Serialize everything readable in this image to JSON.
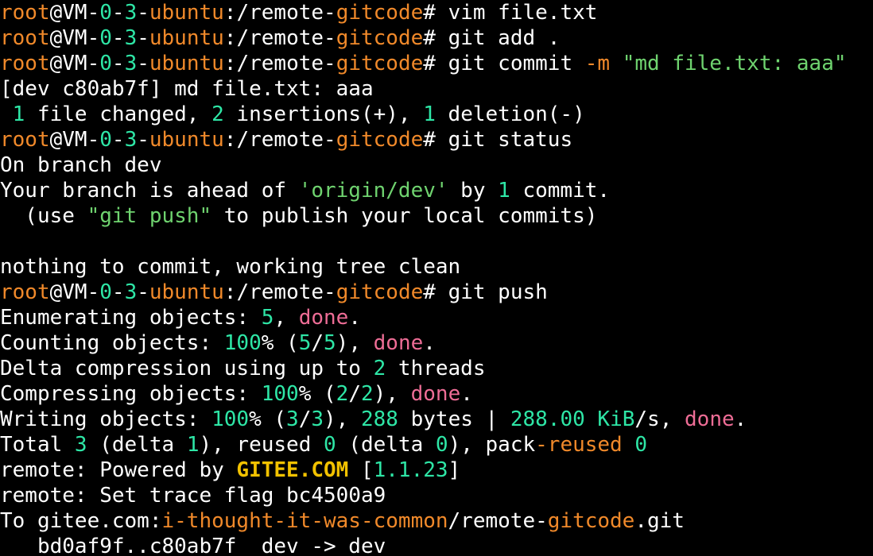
{
  "terminal": {
    "colors": {
      "background": "#000000",
      "foreground": "#ffffff",
      "orange": "#f0892a",
      "number_green": "#2ee6a6",
      "string_green": "#6fd36f",
      "pink": "#ee6d96",
      "yellow": "#f2c200"
    },
    "lines": [
      [
        {
          "t": "root",
          "c": "orange"
        },
        {
          "t": "@VM-",
          "c": "white"
        },
        {
          "t": "0",
          "c": "green"
        },
        {
          "t": "-",
          "c": "white"
        },
        {
          "t": "3",
          "c": "green"
        },
        {
          "t": "-",
          "c": "white"
        },
        {
          "t": "ubuntu",
          "c": "orange"
        },
        {
          "t": ":/remote-",
          "c": "white"
        },
        {
          "t": "gitcode",
          "c": "orange"
        },
        {
          "t": "# vim file.txt",
          "c": "white"
        }
      ],
      [
        {
          "t": "root",
          "c": "orange"
        },
        {
          "t": "@VM-",
          "c": "white"
        },
        {
          "t": "0",
          "c": "green"
        },
        {
          "t": "-",
          "c": "white"
        },
        {
          "t": "3",
          "c": "green"
        },
        {
          "t": "-",
          "c": "white"
        },
        {
          "t": "ubuntu",
          "c": "orange"
        },
        {
          "t": ":/remote-",
          "c": "white"
        },
        {
          "t": "gitcode",
          "c": "orange"
        },
        {
          "t": "# git add .",
          "c": "white"
        }
      ],
      [
        {
          "t": "root",
          "c": "orange"
        },
        {
          "t": "@VM-",
          "c": "white"
        },
        {
          "t": "0",
          "c": "green"
        },
        {
          "t": "-",
          "c": "white"
        },
        {
          "t": "3",
          "c": "green"
        },
        {
          "t": "-",
          "c": "white"
        },
        {
          "t": "ubuntu",
          "c": "orange"
        },
        {
          "t": ":/remote-",
          "c": "white"
        },
        {
          "t": "gitcode",
          "c": "orange"
        },
        {
          "t": "# git commit ",
          "c": "white"
        },
        {
          "t": "-m",
          "c": "orange"
        },
        {
          "t": " ",
          "c": "white"
        },
        {
          "t": "\"md file.txt: aaa\"",
          "c": "strgreen"
        }
      ],
      [
        {
          "t": "[dev c80ab7f] md file.txt: aaa",
          "c": "white"
        }
      ],
      [
        {
          "t": " ",
          "c": "white"
        },
        {
          "t": "1",
          "c": "green"
        },
        {
          "t": " file changed, ",
          "c": "white"
        },
        {
          "t": "2",
          "c": "green"
        },
        {
          "t": " insertions(+), ",
          "c": "white"
        },
        {
          "t": "1",
          "c": "green"
        },
        {
          "t": " deletion(-)",
          "c": "white"
        }
      ],
      [
        {
          "t": "root",
          "c": "orange"
        },
        {
          "t": "@VM-",
          "c": "white"
        },
        {
          "t": "0",
          "c": "green"
        },
        {
          "t": "-",
          "c": "white"
        },
        {
          "t": "3",
          "c": "green"
        },
        {
          "t": "-",
          "c": "white"
        },
        {
          "t": "ubuntu",
          "c": "orange"
        },
        {
          "t": ":/remote-",
          "c": "white"
        },
        {
          "t": "gitcode",
          "c": "orange"
        },
        {
          "t": "# git status",
          "c": "white"
        }
      ],
      [
        {
          "t": "On branch dev",
          "c": "white"
        }
      ],
      [
        {
          "t": "Your branch is ahead of ",
          "c": "white"
        },
        {
          "t": "'origin/dev'",
          "c": "strgreen"
        },
        {
          "t": " by ",
          "c": "white"
        },
        {
          "t": "1",
          "c": "green"
        },
        {
          "t": " commit.",
          "c": "white"
        }
      ],
      [
        {
          "t": "  (use ",
          "c": "white"
        },
        {
          "t": "\"git push\"",
          "c": "strgreen"
        },
        {
          "t": " to publish your local commits)",
          "c": "white"
        }
      ],
      [
        {
          "t": "",
          "c": "white"
        }
      ],
      [
        {
          "t": "nothing to commit, working tree clean",
          "c": "white"
        }
      ],
      [
        {
          "t": "root",
          "c": "orange"
        },
        {
          "t": "@VM-",
          "c": "white"
        },
        {
          "t": "0",
          "c": "green"
        },
        {
          "t": "-",
          "c": "white"
        },
        {
          "t": "3",
          "c": "green"
        },
        {
          "t": "-",
          "c": "white"
        },
        {
          "t": "ubuntu",
          "c": "orange"
        },
        {
          "t": ":/remote-",
          "c": "white"
        },
        {
          "t": "gitcode",
          "c": "orange"
        },
        {
          "t": "# git push",
          "c": "white"
        }
      ],
      [
        {
          "t": "Enumerating objects: ",
          "c": "white"
        },
        {
          "t": "5",
          "c": "green"
        },
        {
          "t": ", ",
          "c": "white"
        },
        {
          "t": "done",
          "c": "pink"
        },
        {
          "t": ".",
          "c": "white"
        }
      ],
      [
        {
          "t": "Counting objects: ",
          "c": "white"
        },
        {
          "t": "100",
          "c": "green"
        },
        {
          "t": "% (",
          "c": "white"
        },
        {
          "t": "5",
          "c": "green"
        },
        {
          "t": "/",
          "c": "white"
        },
        {
          "t": "5",
          "c": "green"
        },
        {
          "t": "), ",
          "c": "white"
        },
        {
          "t": "done",
          "c": "pink"
        },
        {
          "t": ".",
          "c": "white"
        }
      ],
      [
        {
          "t": "Delta compression using up to ",
          "c": "white"
        },
        {
          "t": "2",
          "c": "green"
        },
        {
          "t": " threads",
          "c": "white"
        }
      ],
      [
        {
          "t": "Compressing objects: ",
          "c": "white"
        },
        {
          "t": "100",
          "c": "green"
        },
        {
          "t": "% (",
          "c": "white"
        },
        {
          "t": "2",
          "c": "green"
        },
        {
          "t": "/",
          "c": "white"
        },
        {
          "t": "2",
          "c": "green"
        },
        {
          "t": "), ",
          "c": "white"
        },
        {
          "t": "done",
          "c": "pink"
        },
        {
          "t": ".",
          "c": "white"
        }
      ],
      [
        {
          "t": "Writing objects: ",
          "c": "white"
        },
        {
          "t": "100",
          "c": "green"
        },
        {
          "t": "% (",
          "c": "white"
        },
        {
          "t": "3",
          "c": "green"
        },
        {
          "t": "/",
          "c": "white"
        },
        {
          "t": "3",
          "c": "green"
        },
        {
          "t": "), ",
          "c": "white"
        },
        {
          "t": "288",
          "c": "green"
        },
        {
          "t": " bytes | ",
          "c": "white"
        },
        {
          "t": "288.00 KiB",
          "c": "green"
        },
        {
          "t": "/s, ",
          "c": "white"
        },
        {
          "t": "done",
          "c": "pink"
        },
        {
          "t": ".",
          "c": "white"
        }
      ],
      [
        {
          "t": "Total ",
          "c": "white"
        },
        {
          "t": "3",
          "c": "green"
        },
        {
          "t": " (delta ",
          "c": "white"
        },
        {
          "t": "1",
          "c": "green"
        },
        {
          "t": "), reused ",
          "c": "white"
        },
        {
          "t": "0",
          "c": "green"
        },
        {
          "t": " (delta ",
          "c": "white"
        },
        {
          "t": "0",
          "c": "green"
        },
        {
          "t": "), pack",
          "c": "white"
        },
        {
          "t": "-reused",
          "c": "orange"
        },
        {
          "t": " ",
          "c": "white"
        },
        {
          "t": "0",
          "c": "green"
        }
      ],
      [
        {
          "t": "remote: Powered by ",
          "c": "white"
        },
        {
          "t": "GITEE.COM",
          "c": "yellow"
        },
        {
          "t": " [",
          "c": "white"
        },
        {
          "t": "1.1.23",
          "c": "green"
        },
        {
          "t": "]",
          "c": "white"
        }
      ],
      [
        {
          "t": "remote: Set trace flag bc4500a9",
          "c": "white"
        }
      ],
      [
        {
          "t": "To gitee.com:",
          "c": "white"
        },
        {
          "t": "i-thought-it-was-common",
          "c": "orange"
        },
        {
          "t": "/remote-",
          "c": "white"
        },
        {
          "t": "gitcode",
          "c": "orange"
        },
        {
          "t": ".git",
          "c": "white"
        }
      ],
      [
        {
          "t": "   bd0af9f..c80ab7f  dev -> dev",
          "c": "white"
        }
      ]
    ]
  }
}
